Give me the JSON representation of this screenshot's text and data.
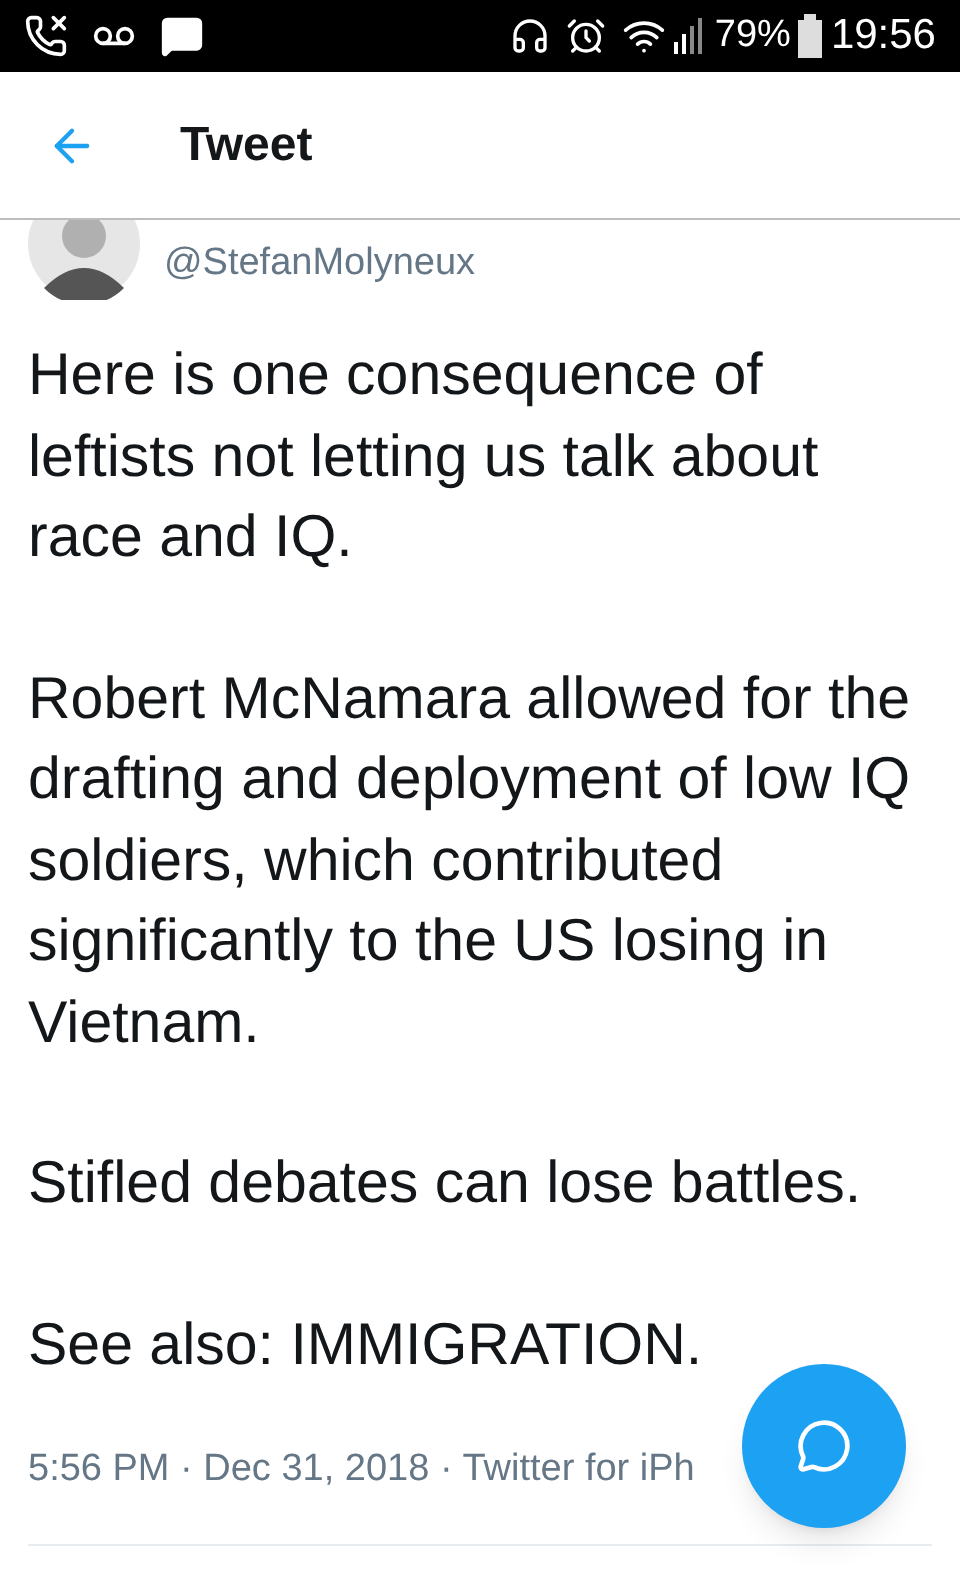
{
  "status_bar": {
    "battery": "79%",
    "time": "19:56"
  },
  "header": {
    "title": "Tweet"
  },
  "tweet": {
    "handle": "@StefanMolyneux",
    "paragraphs": [
      "Here is one consequence of leftists not letting us talk about race and IQ.",
      "Robert McNamara allowed for the drafting and deployment of low IQ soldiers, which contributed significantly to the US losing in Vietnam.",
      "Stifled debates can lose battles.",
      "See also: IMMIGRATION."
    ],
    "meta": "5:56 PM · Dec 31, 2018 · Twitter for iPh"
  }
}
